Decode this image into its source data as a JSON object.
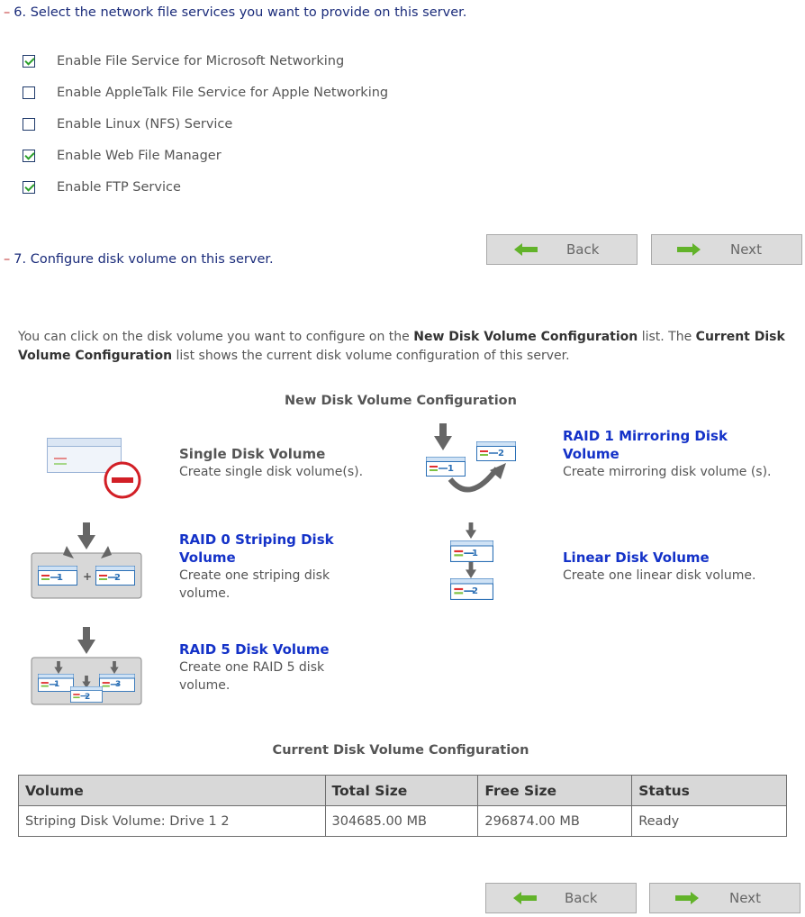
{
  "step6": {
    "dash": "–",
    "title": "6. Select the network file services you want to provide on this server.",
    "services": [
      {
        "label": "Enable File Service for Microsoft Networking",
        "checked": true
      },
      {
        "label": "Enable AppleTalk File Service for Apple Networking",
        "checked": false
      },
      {
        "label": "Enable Linux (NFS) Service",
        "checked": false
      },
      {
        "label": "Enable Web File Manager",
        "checked": true
      },
      {
        "label": "Enable FTP Service",
        "checked": true
      }
    ]
  },
  "nav": {
    "back_label": "Back",
    "next_label": "Next"
  },
  "step7": {
    "dash": "–",
    "title": "7. Configure disk volume on this server.",
    "intro": {
      "p1": "You can click on the disk volume you want to configure on the ",
      "b1": "New Disk Volume Configuration",
      "p2": " list. The ",
      "b2": "Current Disk Volume Configuration",
      "p3": " list shows the current disk volume configuration of this server."
    },
    "new_config_heading": "New Disk Volume Configuration",
    "options": {
      "single": {
        "title": "Single Disk Volume",
        "desc": "Create single disk volume(s)."
      },
      "raid1": {
        "title": "RAID 1 Mirroring Disk Volume",
        "desc": "Create mirroring disk volume (s)."
      },
      "raid0": {
        "title": "RAID 0 Striping Disk Volume",
        "desc": "Create one striping disk volume."
      },
      "linear": {
        "title": "Linear Disk Volume",
        "desc": "Create one linear disk volume."
      },
      "raid5": {
        "title": "RAID 5 Disk Volume",
        "desc": "Create one RAID 5 disk volume."
      }
    },
    "current_config_heading": "Current Disk Volume Configuration",
    "table": {
      "headers": [
        "Volume",
        "Total Size",
        "Free Size",
        "Status"
      ],
      "rows": [
        [
          "Striping Disk Volume: Drive 1 2",
          "304685.00 MB",
          "296874.00 MB",
          "Ready"
        ]
      ]
    }
  },
  "colors": {
    "step_title": "#1a2b7a",
    "link": "#1432c8",
    "check_green": "#2ca02c",
    "arrow_green": "#62b32a",
    "no_entry_red": "#d21f26"
  }
}
